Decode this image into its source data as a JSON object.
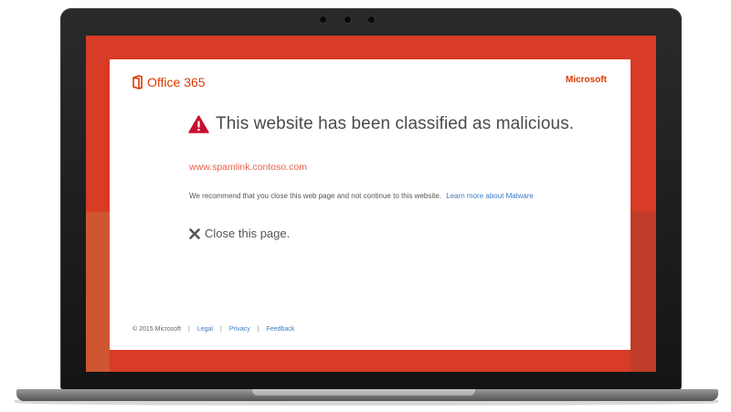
{
  "brand": {
    "name": "Office 365",
    "vendor_link": "Microsoft",
    "logo_icon": "office-logo-icon",
    "accent_color": "#d83b01"
  },
  "warning": {
    "icon": "warning-icon",
    "headline": "This website has been classified as malicious.",
    "url": "www.spamlink.contoso.com",
    "recommendation": "We recommend that you close this web page and not continue to this website.",
    "learn_more": "Learn more about Malware"
  },
  "action": {
    "icon": "close-icon",
    "label": "Close this page."
  },
  "footer": {
    "copyright": "© 2015 Microsoft",
    "separator": "|",
    "links": [
      "Legal",
      "Privacy",
      "Feedback"
    ]
  },
  "colors": {
    "screen_background": "#d83b26",
    "link_blue": "#3b7cc5",
    "url_red": "#e8604a"
  }
}
